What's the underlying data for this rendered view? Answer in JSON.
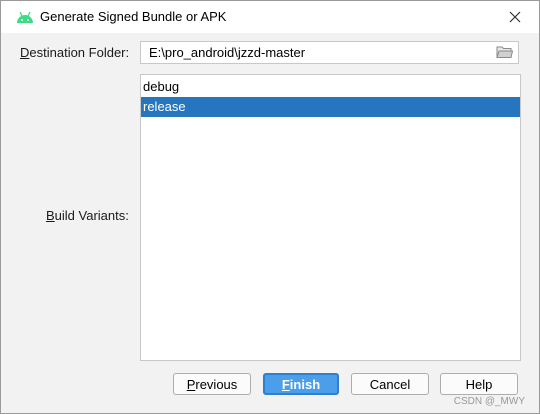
{
  "window": {
    "title": "Generate Signed Bundle or APK",
    "icon": "android-icon",
    "close_icon": "close-icon"
  },
  "destination": {
    "label_mnemonic": "D",
    "label_rest": "estination Folder:",
    "value": "E:\\pro_android\\jzzd-master",
    "browse_icon": "folder-icon"
  },
  "build_variants": {
    "label_mnemonic": "B",
    "label_rest": "uild Variants:",
    "items": [
      {
        "label": "debug",
        "selected": false
      },
      {
        "label": "release",
        "selected": true
      }
    ]
  },
  "buttons": {
    "previous_mnemonic": "P",
    "previous_rest": "revious",
    "finish_mnemonic": "F",
    "finish_rest": "inish",
    "cancel": "Cancel",
    "help": "Help"
  },
  "watermark": "CSDN @_MWY",
  "colors": {
    "selection": "#2675bf",
    "default_button": "#4b9eea",
    "android_green": "#3ddc84"
  }
}
